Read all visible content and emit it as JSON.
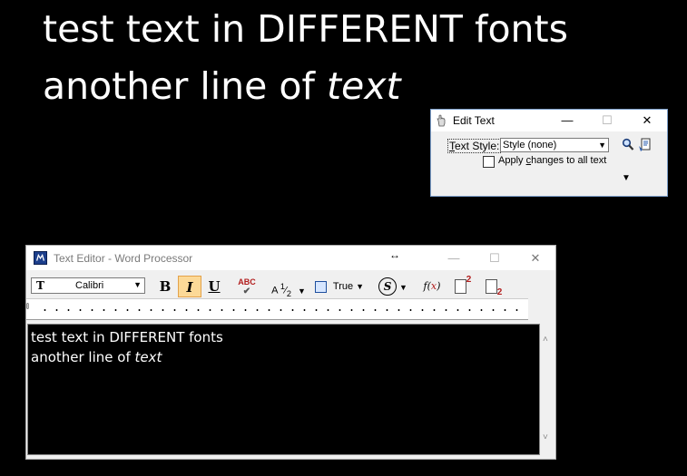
{
  "canvas": {
    "line1": "test text in DIFFERENT fonts",
    "line2_prefix": "another line of ",
    "line2_italic": "text"
  },
  "edit_text": {
    "title": "Edit Text",
    "text_style_label_underlined": "T",
    "text_style_label_rest": "ext Style:",
    "text_style_value": "Style (none)",
    "apply_label_pre": "Apply ",
    "apply_label_underlined": "c",
    "apply_label_post": "hanges to all text",
    "apply_checked": false
  },
  "text_editor": {
    "title": "Text Editor - Word Processor",
    "font_name": "Calibri",
    "bold_label": "B",
    "italic_label": "I",
    "underline_label": "U",
    "spell_label": "ABC",
    "fraction_label": "A",
    "fraction_num": "1",
    "fraction_den": "2",
    "justification_value": "True",
    "symbol_label": "S",
    "function_label_pre": "f(",
    "function_label_x": "x",
    "function_label_post": ")",
    "superscript_label": "2",
    "subscript_label": "2",
    "content_line1": "test text in DIFFERENT fonts",
    "content_line2_prefix": "another line of ",
    "content_line2_italic": "text"
  },
  "colors": {
    "background": "#000000",
    "italic_active": "#fcd997",
    "accent_red": "#b21d1d"
  },
  "icons": {
    "edit_text_app": "hand-pointer-icon",
    "search": "magnifier-icon",
    "properties": "document-properties-icon",
    "text_editor_app": "microstation-icon",
    "resize": "horizontal-resize-icon"
  }
}
